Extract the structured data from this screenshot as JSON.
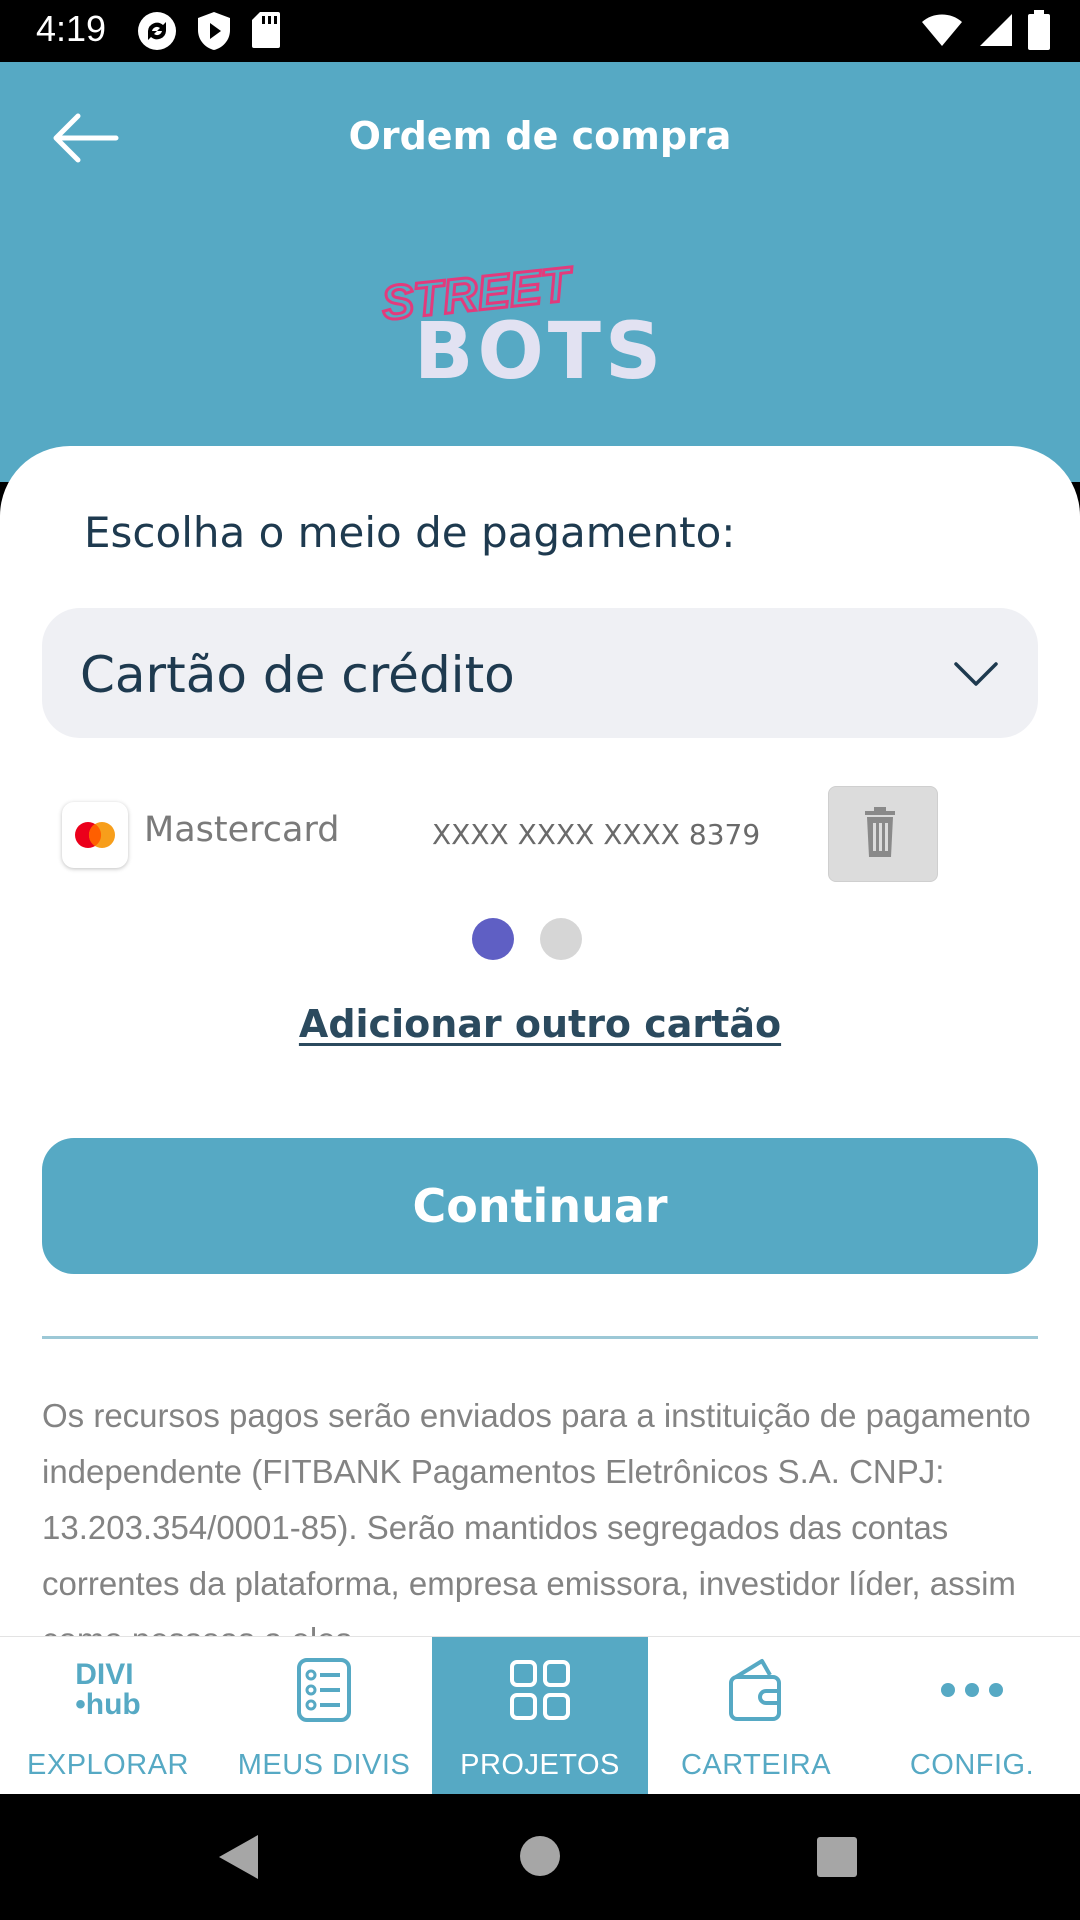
{
  "status_bar": {
    "time": "4:19"
  },
  "header": {
    "title": "Ordem de compra",
    "logo_text_top": "STREET",
    "logo_text_bottom": "BOTS"
  },
  "payment": {
    "section_title": "Escolha o meio de pagamento:",
    "method_selected": "Cartão de crédito",
    "card": {
      "brand": "Mastercard",
      "number": "XXXX XXXX XXXX 8379"
    },
    "carousel_position": 1,
    "carousel_total": 2,
    "add_card_label": "Adicionar outro cartão",
    "continue_label": "Continuar"
  },
  "disclaimer": "Os recursos pagos serão enviados para a instituição de pagamento independente (FITBANK Pagamentos Eletrônicos S.A. CNPJ: 13.203.354/0001-85). Serão mantidos segregados das contas correntes da plataforma, empresa emissora, investidor líder, assim como pessoas a eles",
  "bottom_nav": {
    "logo_line1": "DIVI",
    "logo_line2": "•hub",
    "items": [
      {
        "label": "EXPLORAR",
        "icon": "divihub-logo-icon"
      },
      {
        "label": "MEUS DIVIS",
        "icon": "list-icon"
      },
      {
        "label": "PROJETOS",
        "icon": "grid-icon",
        "active": true
      },
      {
        "label": "CARTEIRA",
        "icon": "wallet-icon"
      },
      {
        "label": "CONFIG.",
        "icon": "more-dots-icon"
      }
    ]
  },
  "colors": {
    "primary": "#56a9c4",
    "dark_text": "#1e3a4f",
    "dot_active": "#5f5fc4",
    "select_bg": "#eff0f4"
  }
}
